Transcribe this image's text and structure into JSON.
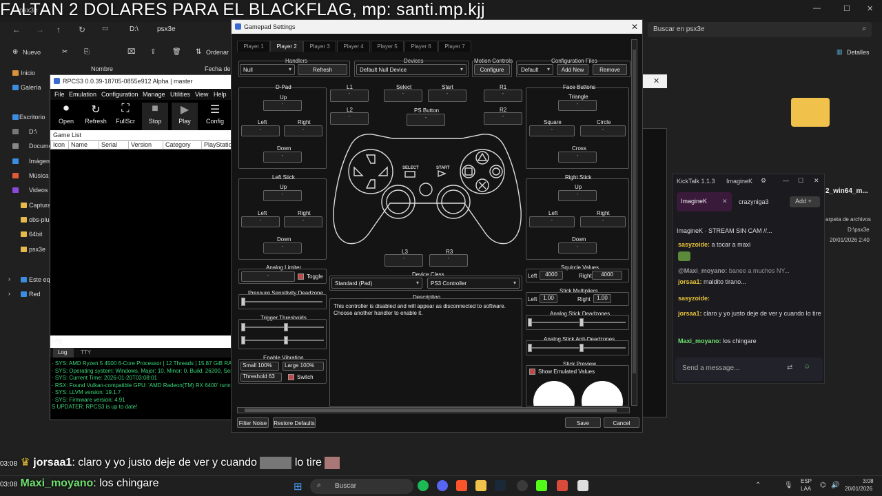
{
  "overlay": {
    "title": "FALTAN 2 DOLARES PARA EL BLACKFLAG, mp: santi.mp.kjj",
    "chat1_time": "03:08",
    "chat1_user": "jorsaa1",
    "chat1_text": ": claro y yo justo deje de ver y cuando",
    "chat1_text2": "lo tire",
    "chat2_time": "03:08",
    "chat2_user": "Maxi_moyano",
    "chat2_text": ": los chingare"
  },
  "explorer": {
    "tab": "psx3e",
    "path": [
      "D:\\",
      "psx3e"
    ],
    "search_placeholder": "Buscar en psx3e",
    "new_label": "Nuevo",
    "sort_label": "Ordenar",
    "details_label": "Detalles",
    "column_name": "Nombre",
    "column_date": "Fecha de n",
    "nav": [
      "Inicio",
      "Galería",
      "Escritorio",
      "D:\\",
      "Documentos",
      "Imágenes",
      "Música",
      "Videos",
      "Capturas",
      "obs-plugins",
      "64bit",
      "psx3e",
      "Este equipo",
      "Red"
    ],
    "file_name": "2_win64_m...",
    "file_desc": "arpeta de archivos",
    "file_path": "D:\\psx3e",
    "file_date": "20/01/2026 2:40"
  },
  "rpcs3": {
    "title": "RPCS3 0.0.39-18705-0855e912 Alpha | master",
    "menu": [
      "File",
      "Emulation",
      "Configuration",
      "Manage",
      "Utilities",
      "View",
      "Help"
    ],
    "tools": [
      {
        "label": "Open",
        "icon": "camera-icon",
        "glyph": "⏺"
      },
      {
        "label": "Refresh",
        "icon": "refresh-icon",
        "glyph": "↻"
      },
      {
        "label": "FullScr",
        "icon": "fullscreen-icon",
        "glyph": "⛶"
      },
      {
        "label": "Stop",
        "icon": "stop-icon",
        "glyph": "■"
      },
      {
        "label": "Play",
        "icon": "play-icon",
        "glyph": "▶"
      },
      {
        "label": "Config",
        "icon": "config-icon",
        "glyph": "☰"
      }
    ],
    "game_list_label": "Game List",
    "columns": [
      "Icon",
      "Name",
      "Serial",
      "Version",
      "Category",
      "PlayStation"
    ],
    "log_label": "Log",
    "log_tabs": [
      "Log",
      "TTY"
    ],
    "log_lines": [
      "· SYS: AMD Ryzen 5 4500 6-Core Processor | 12 Threads | 15.87 GiB RAM | T",
      "· SYS: Operating system: Windows, Major: 10, Minor: 0, Build: 26200, Servic",
      "· SYS: Current Time: 2026-01-20T03:08:01",
      "· RSX: Found Vulkan-compatible GPU: 'AMD Radeon(TM) RX 6400' runnin",
      "· SYS: LLVM version: 19.1.7",
      "· SYS: Firmware version: 4.91",
      "S UPDATER: RPCS3 is up to date!"
    ]
  },
  "gamepad": {
    "title": "Gamepad Settings",
    "tabs": [
      "Player 1",
      "Player 2",
      "Player 3",
      "Player 4",
      "Player 5",
      "Player 6",
      "Player 7"
    ],
    "handlers_label": "Handlers",
    "handler_value": "Null",
    "refresh": "Refresh",
    "devices_label": "Devices",
    "device_value": "Default Null Device",
    "motion_label": "Motion Controls",
    "configure": "Configure",
    "config_files_label": "Configuration Files",
    "config_value": "Default",
    "add_new": "Add New",
    "remove": "Remove",
    "dpad": "D-Pad",
    "up": "Up",
    "left": "Left",
    "right": "Right",
    "down": "Down",
    "l1": "L1",
    "l2": "L2",
    "r1": "R1",
    "r2": "R2",
    "select": "Select",
    "start": "Start",
    "ps_button": "PS Button",
    "l3": "L3",
    "r3": "R3",
    "face_buttons": "Face Buttons",
    "triangle": "Triangle",
    "square": "Square",
    "circle": "Circle",
    "cross": "Cross",
    "left_stick": "Left Stick",
    "right_stick": "Right Stick",
    "pad_select": "SELECT",
    "pad_start": "START",
    "analog_limiter": "Analog Limiter",
    "toggle": "Toggle",
    "device_class": "Device Class",
    "class_value": "Standard (Pad)",
    "class_value2": "PS3 Controller",
    "squircle": "Squircle Values",
    "sq_left": "4000",
    "sq_right": "4000",
    "stick_mult": "Stick Multipliers",
    "mult_left": "1.00",
    "mult_right": "1.00",
    "pressure": "Pressure Sensitivity Deadzone",
    "trigger": "Trigger Thresholds",
    "description": "Description",
    "desc_text": "This controller is disabled and will appear as disconnected to software. Choose another handler to enable it.",
    "deadzones": "Analog Stick Deadzones",
    "anti_deadzones": "Analog Stick Anti-Deadzones",
    "vibration": "Enable Vibration",
    "small": "Small 100%",
    "large": "Large 100%",
    "threshold": "Threshold 63",
    "switch": "Switch",
    "stick_preview": "Stick Preview",
    "show_emulated": "Show Emulated Values",
    "filter_noise": "Filter Noise",
    "restore_defaults": "Restore Defaults",
    "save": "Save",
    "cancel": "Cancel",
    "dash": "-"
  },
  "kicktalk": {
    "title": "KickTalk 1.1.3",
    "user": "ImagineK",
    "tab_active": "ImagineK",
    "tab2": "crazyniga3",
    "add": "Add",
    "stream": "ImagineK · STREAM SIN CAM //...",
    "messages": [
      {
        "user": "sasyzoide:",
        "text": "a tocar a maxi",
        "color": "#e8c23a"
      },
      {
        "user": "@Maxi_moyano:",
        "text": "banee a muchos NY...",
        "color": "#999"
      },
      {
        "user": "jorsaa1:",
        "text": "maldito tirano...",
        "color": "#e8c23a"
      },
      {
        "user": "sasyzoide:",
        "text": "",
        "color": "#e8c23a"
      },
      {
        "user": "jorsaa1:",
        "text": "claro y yo justo deje de ver y cuando    lo tire",
        "color": "#e8c23a"
      },
      {
        "user": "Maxi_moyano:",
        "text": "los chingare",
        "color": "#6ee06e"
      }
    ],
    "input_placeholder": "Send a message..."
  },
  "taskbar": {
    "search": "Buscar",
    "lang": "ESP",
    "lang2": "LAA",
    "time": "3:08",
    "date": "20/01/2026"
  }
}
